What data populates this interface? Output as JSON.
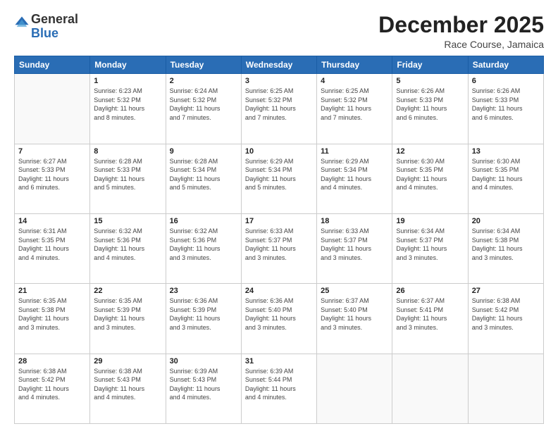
{
  "header": {
    "logo_general": "General",
    "logo_blue": "Blue",
    "title": "December 2025",
    "subtitle": "Race Course, Jamaica"
  },
  "columns": [
    "Sunday",
    "Monday",
    "Tuesday",
    "Wednesday",
    "Thursday",
    "Friday",
    "Saturday"
  ],
  "weeks": [
    [
      {
        "day": "",
        "info": ""
      },
      {
        "day": "1",
        "info": "Sunrise: 6:23 AM\nSunset: 5:32 PM\nDaylight: 11 hours\nand 8 minutes."
      },
      {
        "day": "2",
        "info": "Sunrise: 6:24 AM\nSunset: 5:32 PM\nDaylight: 11 hours\nand 7 minutes."
      },
      {
        "day": "3",
        "info": "Sunrise: 6:25 AM\nSunset: 5:32 PM\nDaylight: 11 hours\nand 7 minutes."
      },
      {
        "day": "4",
        "info": "Sunrise: 6:25 AM\nSunset: 5:32 PM\nDaylight: 11 hours\nand 7 minutes."
      },
      {
        "day": "5",
        "info": "Sunrise: 6:26 AM\nSunset: 5:33 PM\nDaylight: 11 hours\nand 6 minutes."
      },
      {
        "day": "6",
        "info": "Sunrise: 6:26 AM\nSunset: 5:33 PM\nDaylight: 11 hours\nand 6 minutes."
      }
    ],
    [
      {
        "day": "7",
        "info": "Sunrise: 6:27 AM\nSunset: 5:33 PM\nDaylight: 11 hours\nand 6 minutes."
      },
      {
        "day": "8",
        "info": "Sunrise: 6:28 AM\nSunset: 5:33 PM\nDaylight: 11 hours\nand 5 minutes."
      },
      {
        "day": "9",
        "info": "Sunrise: 6:28 AM\nSunset: 5:34 PM\nDaylight: 11 hours\nand 5 minutes."
      },
      {
        "day": "10",
        "info": "Sunrise: 6:29 AM\nSunset: 5:34 PM\nDaylight: 11 hours\nand 5 minutes."
      },
      {
        "day": "11",
        "info": "Sunrise: 6:29 AM\nSunset: 5:34 PM\nDaylight: 11 hours\nand 4 minutes."
      },
      {
        "day": "12",
        "info": "Sunrise: 6:30 AM\nSunset: 5:35 PM\nDaylight: 11 hours\nand 4 minutes."
      },
      {
        "day": "13",
        "info": "Sunrise: 6:30 AM\nSunset: 5:35 PM\nDaylight: 11 hours\nand 4 minutes."
      }
    ],
    [
      {
        "day": "14",
        "info": "Sunrise: 6:31 AM\nSunset: 5:35 PM\nDaylight: 11 hours\nand 4 minutes."
      },
      {
        "day": "15",
        "info": "Sunrise: 6:32 AM\nSunset: 5:36 PM\nDaylight: 11 hours\nand 4 minutes."
      },
      {
        "day": "16",
        "info": "Sunrise: 6:32 AM\nSunset: 5:36 PM\nDaylight: 11 hours\nand 3 minutes."
      },
      {
        "day": "17",
        "info": "Sunrise: 6:33 AM\nSunset: 5:37 PM\nDaylight: 11 hours\nand 3 minutes."
      },
      {
        "day": "18",
        "info": "Sunrise: 6:33 AM\nSunset: 5:37 PM\nDaylight: 11 hours\nand 3 minutes."
      },
      {
        "day": "19",
        "info": "Sunrise: 6:34 AM\nSunset: 5:37 PM\nDaylight: 11 hours\nand 3 minutes."
      },
      {
        "day": "20",
        "info": "Sunrise: 6:34 AM\nSunset: 5:38 PM\nDaylight: 11 hours\nand 3 minutes."
      }
    ],
    [
      {
        "day": "21",
        "info": "Sunrise: 6:35 AM\nSunset: 5:38 PM\nDaylight: 11 hours\nand 3 minutes."
      },
      {
        "day": "22",
        "info": "Sunrise: 6:35 AM\nSunset: 5:39 PM\nDaylight: 11 hours\nand 3 minutes."
      },
      {
        "day": "23",
        "info": "Sunrise: 6:36 AM\nSunset: 5:39 PM\nDaylight: 11 hours\nand 3 minutes."
      },
      {
        "day": "24",
        "info": "Sunrise: 6:36 AM\nSunset: 5:40 PM\nDaylight: 11 hours\nand 3 minutes."
      },
      {
        "day": "25",
        "info": "Sunrise: 6:37 AM\nSunset: 5:40 PM\nDaylight: 11 hours\nand 3 minutes."
      },
      {
        "day": "26",
        "info": "Sunrise: 6:37 AM\nSunset: 5:41 PM\nDaylight: 11 hours\nand 3 minutes."
      },
      {
        "day": "27",
        "info": "Sunrise: 6:38 AM\nSunset: 5:42 PM\nDaylight: 11 hours\nand 3 minutes."
      }
    ],
    [
      {
        "day": "28",
        "info": "Sunrise: 6:38 AM\nSunset: 5:42 PM\nDaylight: 11 hours\nand 4 minutes."
      },
      {
        "day": "29",
        "info": "Sunrise: 6:38 AM\nSunset: 5:43 PM\nDaylight: 11 hours\nand 4 minutes."
      },
      {
        "day": "30",
        "info": "Sunrise: 6:39 AM\nSunset: 5:43 PM\nDaylight: 11 hours\nand 4 minutes."
      },
      {
        "day": "31",
        "info": "Sunrise: 6:39 AM\nSunset: 5:44 PM\nDaylight: 11 hours\nand 4 minutes."
      },
      {
        "day": "",
        "info": ""
      },
      {
        "day": "",
        "info": ""
      },
      {
        "day": "",
        "info": ""
      }
    ]
  ]
}
